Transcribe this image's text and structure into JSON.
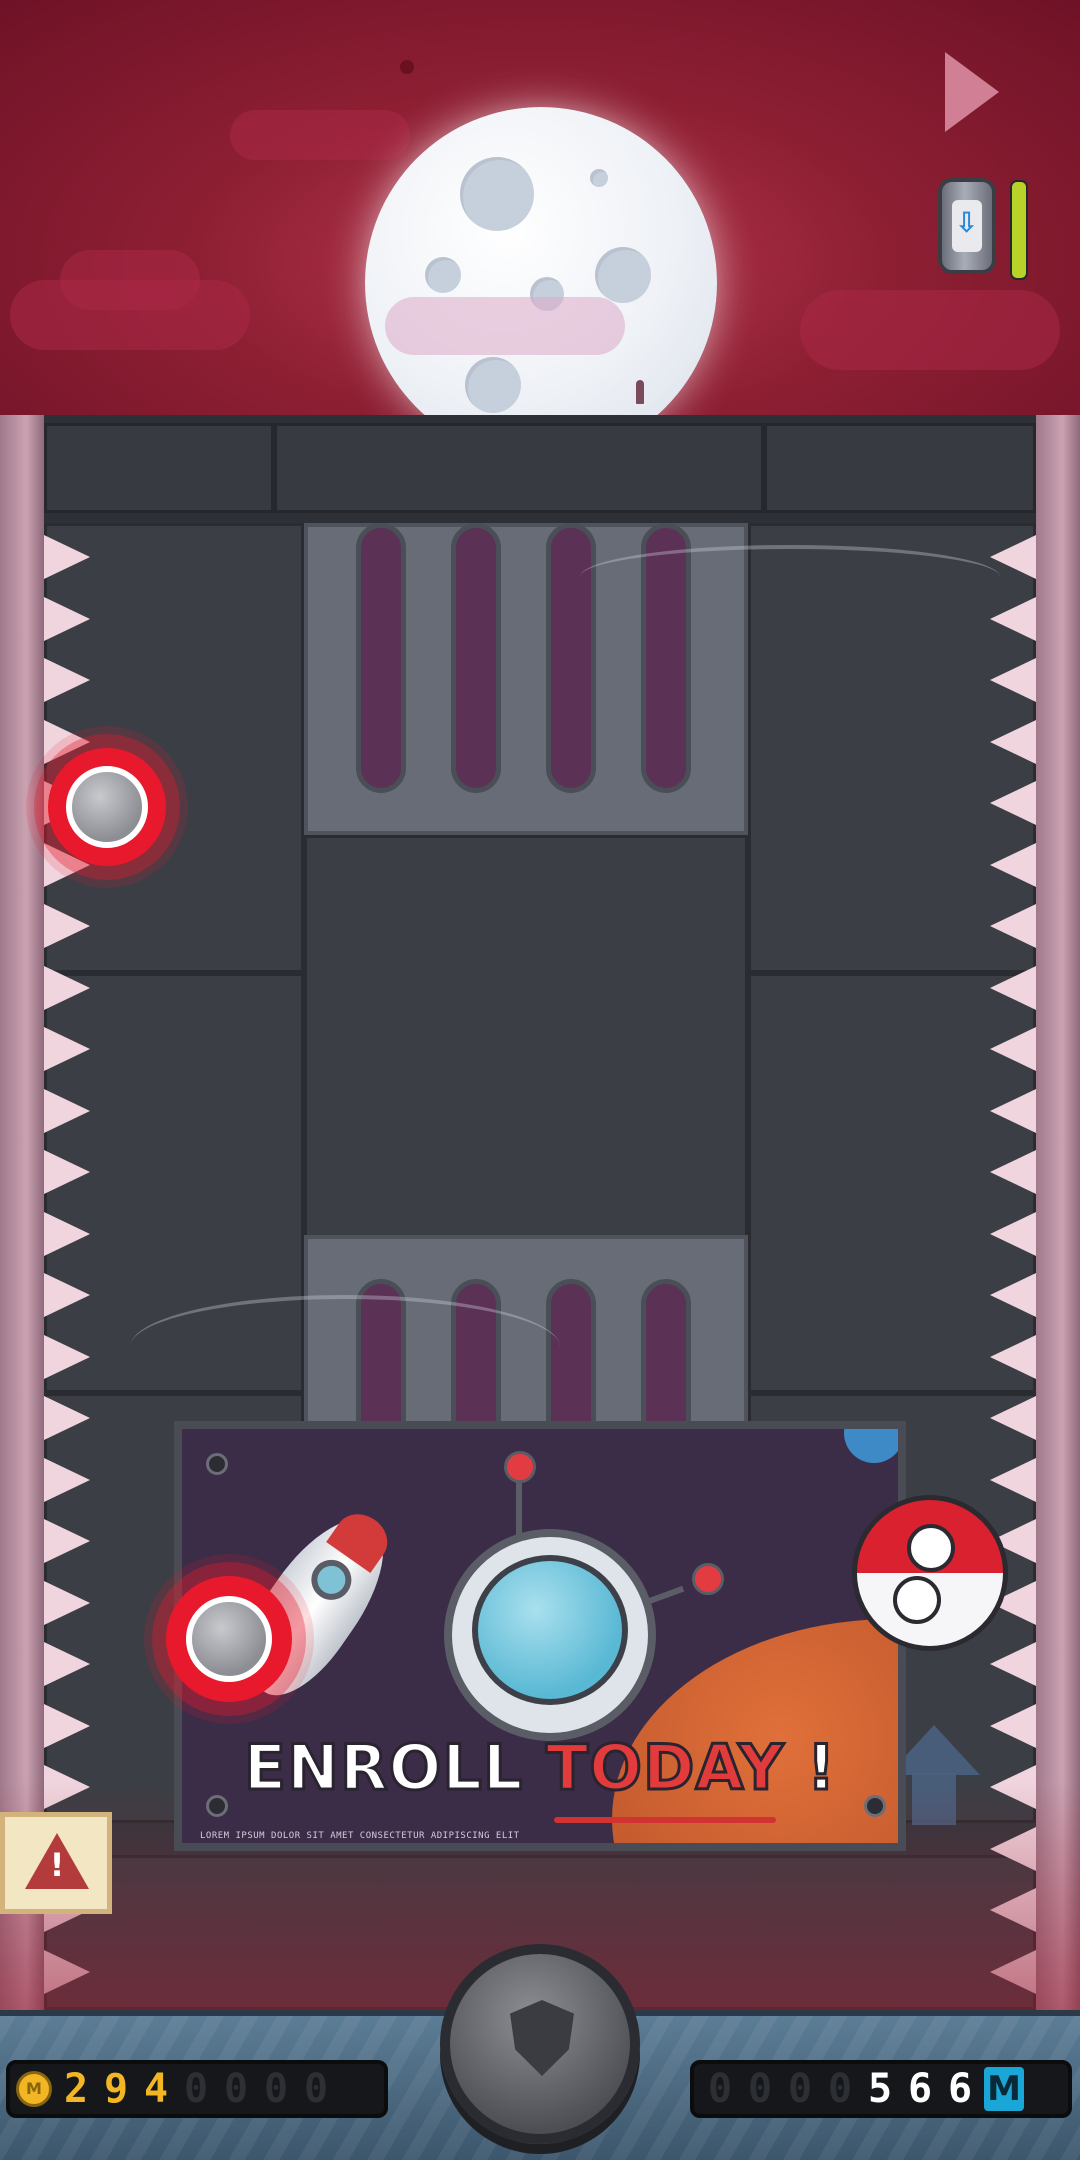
{
  "hud": {
    "coins": {
      "icon": "coin-icon",
      "coin_symbol": "M",
      "digits": [
        "2",
        "9",
        "4",
        "0",
        "0",
        "0",
        "0"
      ],
      "lit": 3
    },
    "distance": {
      "digits": [
        "0",
        "0",
        "0",
        "0",
        "5",
        "6",
        "6"
      ],
      "lit_from": 4,
      "unit": "M"
    },
    "shield_button": "shield-icon"
  },
  "top_controls": {
    "play_button": "play-icon",
    "fuel_canister": "fuel-canister-icon",
    "fuel_level": 1.0
  },
  "billboard": {
    "headline_part1": "ENROLL",
    "headline_part2": "TODAY",
    "headline_part3": "!",
    "fine_print": "LOREM IPSUM DOLOR SIT AMET CONSECTETUR ADIPISCING ELIT"
  },
  "warning_badge": {
    "icon": "warning-icon",
    "symbol": "!"
  },
  "colors": {
    "sky": "#8e1f33",
    "ring": "#e8192c",
    "accent": "#f2b624",
    "unit": "#1aa7d8"
  }
}
